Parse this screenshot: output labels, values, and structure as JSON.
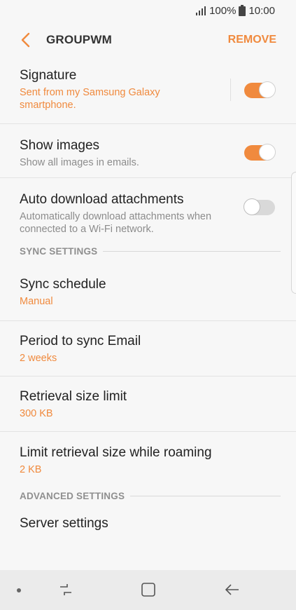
{
  "status_bar": {
    "battery": "100%",
    "time": "10:00"
  },
  "header": {
    "title": "GROUPWM",
    "remove_label": "REMOVE"
  },
  "items": [
    {
      "title": "Signature",
      "subtitle": "Sent from my Samsung Galaxy smartphone.",
      "toggle": "on"
    },
    {
      "title": "Show images",
      "subtitle": "Show all images in emails.",
      "toggle": "on"
    },
    {
      "title": "Auto download attachments",
      "subtitle": "Automatically download attachments when connected to a Wi-Fi network.",
      "toggle": "off"
    }
  ],
  "sync_section": {
    "header": "SYNC SETTINGS",
    "items": [
      {
        "title": "Sync schedule",
        "value": "Manual"
      },
      {
        "title": "Period to sync Email",
        "value": "2 weeks"
      },
      {
        "title": "Retrieval size limit",
        "value": "300 KB"
      },
      {
        "title": "Limit retrieval size while roaming",
        "value": "2 KB"
      }
    ]
  },
  "advanced_section": {
    "header": "ADVANCED SETTINGS",
    "items": [
      {
        "title": "Server settings"
      }
    ]
  },
  "colors": {
    "accent": "#f08a3e",
    "background": "#f7f7f7",
    "nav_bar": "#ebebeb"
  }
}
